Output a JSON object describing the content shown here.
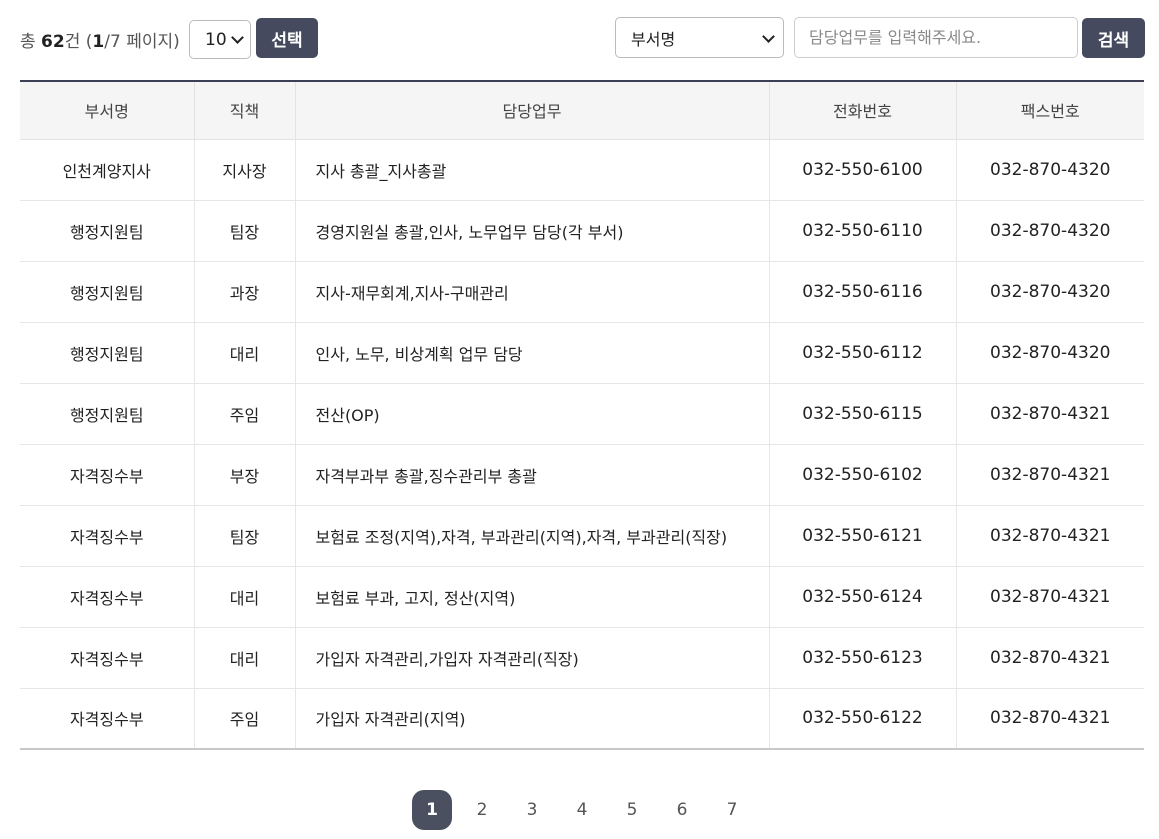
{
  "summary": {
    "prefix": "총 ",
    "total": "62",
    "unit": "건 (",
    "page": "1",
    "pages": "/7 페이지)"
  },
  "page_size": {
    "value": "10",
    "options": [
      "10"
    ]
  },
  "buttons": {
    "select": "선택",
    "search": "검색"
  },
  "search": {
    "field": "부서명",
    "placeholder": "담당업무를 입력해주세요."
  },
  "table": {
    "columns": [
      "부서명",
      "직책",
      "담당업무",
      "전화번호",
      "팩스번호"
    ],
    "rows": [
      [
        "인천계양지사",
        "지사장",
        "지사 총괄_지사총괄",
        "032-550-6100",
        "032-870-4320"
      ],
      [
        "행정지원팀",
        "팀장",
        "경영지원실 총괄,인사, 노무업무 담당(각 부서)",
        "032-550-6110",
        "032-870-4320"
      ],
      [
        "행정지원팀",
        "과장",
        "지사-재무회계,지사-구매관리",
        "032-550-6116",
        "032-870-4320"
      ],
      [
        "행정지원팀",
        "대리",
        "인사, 노무, 비상계획 업무 담당",
        "032-550-6112",
        "032-870-4320"
      ],
      [
        "행정지원팀",
        "주임",
        "전산(OP)",
        "032-550-6115",
        "032-870-4321"
      ],
      [
        "자격징수부",
        "부장",
        "자격부과부 총괄,징수관리부 총괄",
        "032-550-6102",
        "032-870-4321"
      ],
      [
        "자격징수부",
        "팀장",
        "보험료 조정(지역),자격, 부과관리(지역),자격, 부과관리(직장)",
        "032-550-6121",
        "032-870-4321"
      ],
      [
        "자격징수부",
        "대리",
        "보험료 부과, 고지, 정산(지역)",
        "032-550-6124",
        "032-870-4321"
      ],
      [
        "자격징수부",
        "대리",
        "가입자 자격관리,가입자 자격관리(직장)",
        "032-550-6123",
        "032-870-4321"
      ],
      [
        "자격징수부",
        "주임",
        "가입자 자격관리(지역)",
        "032-550-6122",
        "032-870-4321"
      ]
    ]
  },
  "pagination": {
    "pages": [
      "1",
      "2",
      "3",
      "4",
      "5",
      "6",
      "7"
    ],
    "current": "1"
  },
  "colors": {
    "dark_button": "#454a5e",
    "active_page": "#4a5060",
    "header_bg": "#f5f5f5",
    "top_border": "#3d3f55"
  },
  "icons": {
    "select_arrow": "chevron-down-icon"
  }
}
